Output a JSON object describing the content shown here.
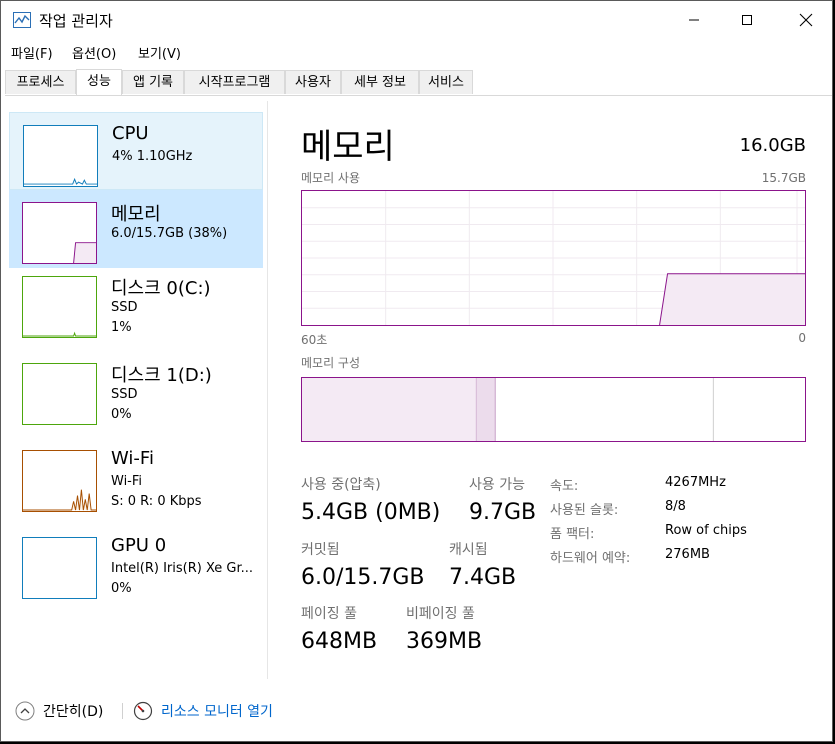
{
  "window": {
    "title": "작업 관리자"
  },
  "menu": [
    "파일(F)",
    "옵션(O)",
    "보기(V)"
  ],
  "tabs": [
    "프로세스",
    "성능",
    "앱 기록",
    "시작프로그램",
    "사용자",
    "세부 정보",
    "서비스"
  ],
  "active_tab": "성능",
  "sidebar": [
    {
      "title": "CPU",
      "sub1": "4% 1.10GHz",
      "sub2": ""
    },
    {
      "title": "메모리",
      "sub1": "6.0/15.7GB (38%)",
      "sub2": ""
    },
    {
      "title": "디스크 0(C:)",
      "sub1": "SSD",
      "sub2": "1%"
    },
    {
      "title": "디스크 1(D:)",
      "sub1": "SSD",
      "sub2": "0%"
    },
    {
      "title": "Wi-Fi",
      "sub1": "Wi-Fi",
      "sub2": "S: 0  R: 0 Kbps"
    },
    {
      "title": "GPU 0",
      "sub1": "Intel(R) Iris(R) Xe Gr...",
      "sub2": "0%"
    }
  ],
  "main": {
    "title": "메모리",
    "total": "16.0GB",
    "usage_label": "메모리 사용",
    "usage_max": "15.7GB",
    "axis_left": "60초",
    "axis_right": "0",
    "composition_label": "메모리 구성",
    "stats": {
      "in_use_label": "사용 중(압축)",
      "in_use_value": "5.4GB  (0MB)",
      "available_label": "사용 가능",
      "available_value": "9.7GB",
      "committed_label": "커밋됨",
      "committed_value": "6.0/15.7GB",
      "cached_label": "캐시됨",
      "cached_value": "7.4GB",
      "paged_label": "페이징 풀",
      "paged_value": "648MB",
      "nonpaged_label": "비페이징 풀",
      "nonpaged_value": "369MB"
    },
    "details": [
      {
        "label": "속도:",
        "value": "4267MHz"
      },
      {
        "label": "사용된 슬롯:",
        "value": "8/8"
      },
      {
        "label": "폼 팩터:",
        "value": "Row of chips"
      },
      {
        "label": "하드웨어 예약:",
        "value": "276MB"
      }
    ]
  },
  "footer": {
    "collapse": "간단히(D)",
    "resource_monitor": "리소스 모니터 열기"
  },
  "colors": {
    "memory": "#8b148b",
    "cpu": "#117dbb",
    "disk": "#4da60c",
    "wifi": "#a74f01",
    "gpu": "#117dbb"
  }
}
